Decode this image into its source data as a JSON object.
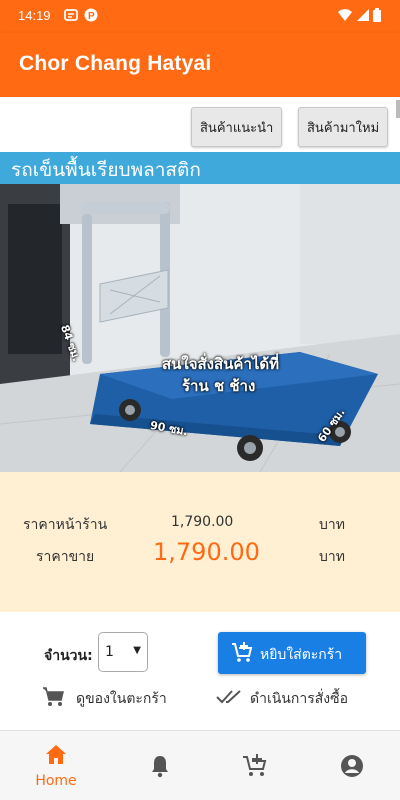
{
  "status_bar": {
    "time": "14:19"
  },
  "app_bar": {
    "title": "Chor Chang Hatyai"
  },
  "tabs": [
    {
      "label": "สินค้าแนะนำ"
    },
    {
      "label": "สินค้ามาใหม่"
    }
  ],
  "product": {
    "name": "รถเข็นพื้นเรียบพลาสติก",
    "image_text": {
      "line1": "สนใจสั่งสินค้าได้ที่",
      "line2": "ร้าน ช ช้าง",
      "dim_height": "84 ซม.",
      "dim_length": "90 ซม.",
      "dim_width": "60 ซม."
    }
  },
  "pricing": {
    "store_price_label": "ราคาหน้าร้าน",
    "store_price_value": "1,790.00",
    "store_price_unit": "บาท",
    "sale_price_label": "ราคาขาย",
    "sale_price_value": "1,790.00",
    "sale_price_unit": "บาท"
  },
  "order": {
    "quantity_label": "จำนวน:",
    "quantity_value": "1",
    "add_to_cart_label": "หยิบใส่ตะกร้า",
    "view_cart_label": "ดูของในตะกร้า",
    "checkout_label": "ดำเนินการสั่งซื้อ"
  },
  "bottom_nav": {
    "items": [
      {
        "label": "Home",
        "icon": "home-icon",
        "active": true
      },
      {
        "label": "",
        "icon": "bell-icon",
        "active": false
      },
      {
        "label": "",
        "icon": "cart-add-icon",
        "active": false
      },
      {
        "label": "",
        "icon": "account-icon",
        "active": false
      }
    ]
  },
  "colors": {
    "primary": "#ff6a13",
    "title_strip": "#3fa9dc",
    "button_blue": "#1a7fe5",
    "price_panel": "#fff0d4"
  }
}
